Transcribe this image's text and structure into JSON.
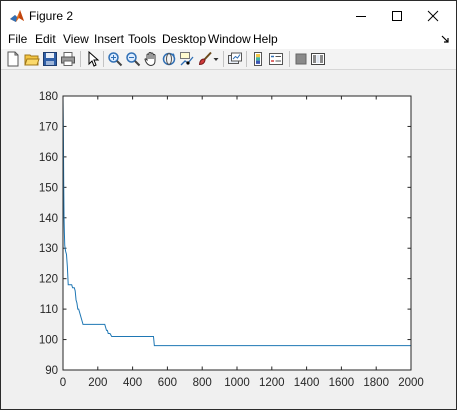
{
  "window": {
    "title": "Figure 2",
    "controls": {
      "minimize": "minimize",
      "maximize": "maximize",
      "close": "close"
    }
  },
  "menubar": {
    "items": [
      "File",
      "Edit",
      "View",
      "Insert",
      "Tools",
      "Desktop",
      "Window",
      "Help"
    ]
  },
  "toolbar": {
    "buttons": [
      "new-figure-icon",
      "open-file-icon",
      "save-icon",
      "print-icon",
      "edit-plot-pointer-icon",
      "zoom-in-icon",
      "zoom-out-icon",
      "pan-hand-icon",
      "rotate-3d-icon",
      "data-cursor-icon",
      "brush-icon",
      "link-plot-icon",
      "insert-colorbar-icon",
      "insert-legend-icon",
      "hide-plot-tools-icon",
      "show-plot-tools-icon"
    ]
  },
  "colors": {
    "line": "#1f77b4",
    "axes_background": "#ffffff",
    "figure_background": "#f0f0f0"
  },
  "chart_data": {
    "type": "line",
    "title": "",
    "xlabel": "",
    "ylabel": "",
    "xlim": [
      0,
      2000
    ],
    "ylim": [
      90,
      180
    ],
    "grid": false,
    "x_ticks": [
      0,
      200,
      400,
      600,
      800,
      1000,
      1200,
      1400,
      1600,
      1800,
      2000
    ],
    "y_ticks": [
      90,
      100,
      110,
      120,
      130,
      140,
      150,
      160,
      170,
      180
    ],
    "series": [
      {
        "x": [
          0,
          2,
          4,
          6,
          8,
          10,
          12,
          15,
          20,
          25,
          30,
          50,
          55,
          60,
          65,
          70,
          75,
          80,
          85,
          90,
          95,
          100,
          105,
          110,
          115,
          240,
          245,
          250,
          255,
          260,
          265,
          270,
          280,
          290,
          300,
          320,
          520,
          525,
          2000
        ],
        "y": [
          180,
          170,
          152,
          140,
          135,
          131,
          130,
          129,
          128,
          124,
          118,
          118,
          117,
          117,
          117,
          116,
          113,
          112,
          110,
          110,
          109,
          108,
          107,
          106,
          105,
          105,
          104,
          103,
          103,
          102,
          102,
          102,
          101,
          101,
          101,
          101,
          101,
          98,
          98
        ]
      }
    ]
  }
}
